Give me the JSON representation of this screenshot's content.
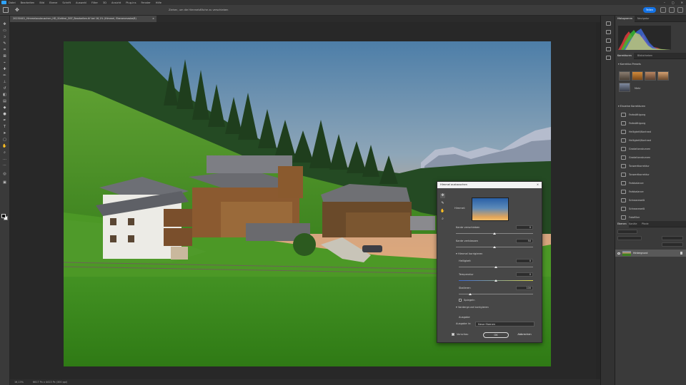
{
  "menu": {
    "items": [
      "Datei",
      "Bearbeiten",
      "Bild",
      "Ebene",
      "Schrift",
      "Auswahl",
      "Filter",
      "3D",
      "Ansicht",
      "Plug-ins",
      "Fenster",
      "Hilfe"
    ]
  },
  "options": {
    "hint": "Ziehen, um die Himmelsfläche zu verschieben",
    "share_label": "Teilen"
  },
  "document": {
    "tab_title": "20230401_Himmelaustauschen_HD_Südtirol_DSF_Bearbeiten.tif bei 16,1% (Himmel, Ebenenmaske/8)"
  },
  "status": {
    "zoom": "16,13%",
    "dims": "6617 Px x 4413 Px (300 ppi)"
  },
  "panels": {
    "top_tabs": [
      "Histogramm",
      "Navigator"
    ],
    "mid_tabs": [
      "Korrekturen",
      "Bibliotheken"
    ],
    "presets_title": "Korrektur-Presets",
    "more_label": "Mehr",
    "adjust_title": "Einzelne Korrekturen",
    "adjust_items": [
      "Farbsättigung",
      "Farbsättigung",
      "Helligkeit/Kontrast",
      "Helligkeit/Kontrast",
      "Gradationskurven",
      "Gradationskurven",
      "Tonwertkorrektur",
      "Tonwertkorrektur",
      "Farbbalance",
      "Farbbalance",
      "Schwarzweiß",
      "Schwarzweiß",
      "Fotofilter"
    ],
    "layer_tabs": [
      "Ebenen",
      "Kanäle",
      "Pfade"
    ],
    "layer_name": "Hintergrund"
  },
  "colors": {
    "accent": "#1473e6",
    "panel_bg": "#3a3a3a",
    "canvas_bg": "#282828"
  },
  "dialog": {
    "title": "Himmel austauschen",
    "sky_label": "Himmel:",
    "fields": [
      {
        "label": "Kante verschieben",
        "value": "0"
      },
      {
        "label": "Kante verblassen",
        "value": "50"
      },
      {
        "label": "Helligkeit",
        "value": "0"
      },
      {
        "label": "Temperatur",
        "value": "0"
      },
      {
        "label": "Skalieren",
        "value": "100"
      }
    ],
    "section_foreground": "Himmel korrigieren",
    "flip_label": "Spiegeln",
    "lighting_label": "Vordergrund korrigieren",
    "output_title": "Ausgabe",
    "output_to_label": "Ausgabe in:",
    "output_to_value": "Neue Ebenen",
    "preview_label": "Vorschau",
    "ok_label": "OK",
    "cancel_label": "Abbrechen"
  }
}
